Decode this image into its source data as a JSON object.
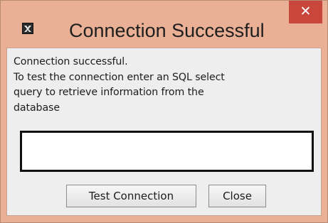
{
  "dialog": {
    "title": "Connection Successful",
    "close_glyph": "✕",
    "icon": "java-app-icon",
    "title_bar_color": "#e9b095",
    "close_button_color": "#c9463d"
  },
  "message": {
    "lines": [
      "Connection successful.",
      "To test the connection enter an SQL select",
      "query to retrieve information from the",
      "database"
    ]
  },
  "query_input": {
    "value": "",
    "placeholder": ""
  },
  "buttons": {
    "test_label": "Test Connection",
    "close_label": "Close"
  }
}
